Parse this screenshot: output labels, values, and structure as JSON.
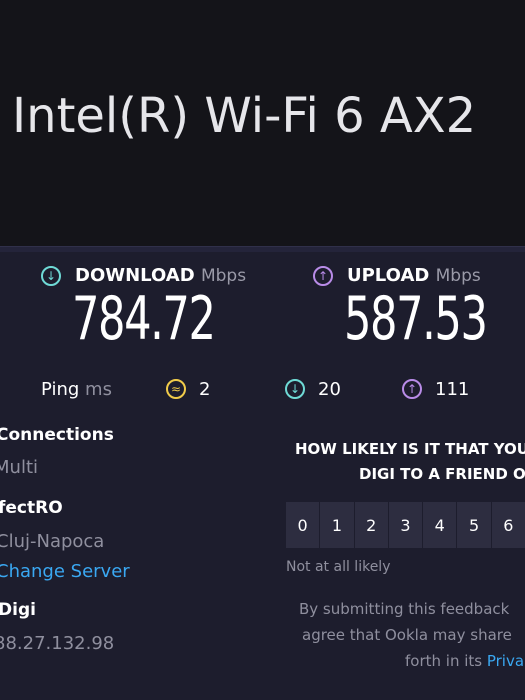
{
  "adapter": {
    "name": "Intel(R) Wi-Fi 6 AX2"
  },
  "download": {
    "label": "DOWNLOAD",
    "unit": "Mbps",
    "value": "784.72"
  },
  "upload": {
    "label": "UPLOAD",
    "unit": "Mbps",
    "value": "587.53"
  },
  "ping": {
    "label": "Ping",
    "unit": "ms",
    "idle": "2",
    "download": "20",
    "upload": "111"
  },
  "connections": {
    "label": "Connections",
    "value": "Multi"
  },
  "server": {
    "name": "fectRO",
    "location": "Cluj-Napoca",
    "change_label": "Change Server"
  },
  "provider": {
    "name": "Digi",
    "ip": "88.27.132.98"
  },
  "survey": {
    "question_line1": "HOW LIKELY IS IT THAT YOU",
    "question_line2": "DIGI TO A FRIEND O",
    "ratings": [
      "0",
      "1",
      "2",
      "3",
      "4",
      "5",
      "6"
    ],
    "low_label": "Not at all likely",
    "footer_line1": "By submitting this feedback",
    "footer_line2": "agree that Ookla may share",
    "footer_line3_prefix": "forth in its ",
    "footer_link": "Priva"
  },
  "colors": {
    "download": "#6fdad6",
    "upload": "#b98ce8",
    "idle": "#f1cc4a",
    "link": "#3aa8f2"
  },
  "icons": {
    "download": "arrow-down-circle-icon",
    "upload": "arrow-up-circle-icon",
    "idle": "idle-latency-icon"
  }
}
